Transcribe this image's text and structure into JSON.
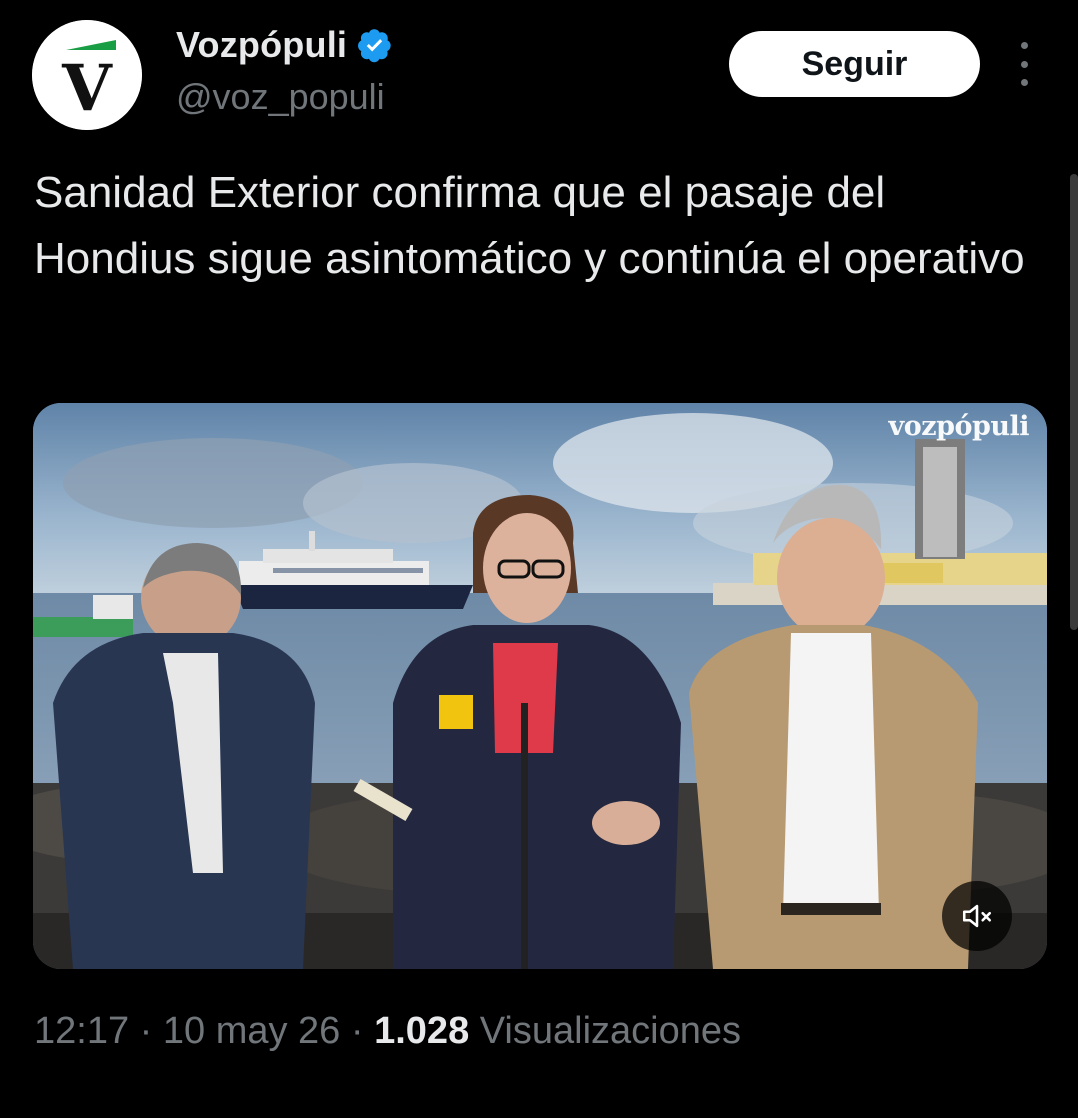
{
  "account": {
    "name": "Vozpópuli",
    "handle": "@voz_populi",
    "verified": true,
    "avatar_letter": "V"
  },
  "follow_button": {
    "label": "Seguir"
  },
  "more_icon": "more-vertical-icon",
  "tweet": {
    "text": "Sanidad Exterior confirma que el pasaje del Hondius sigue asintomático y continúa el operativo"
  },
  "media": {
    "watermark": "vozpópuli",
    "mute_icon": "speaker-muted-icon"
  },
  "meta": {
    "time": "12:17",
    "separator": "·",
    "date": "10 may 26",
    "views_count": "1.028",
    "views_label": "Visualizaciones"
  },
  "colors": {
    "background": "#000000",
    "text_primary": "#e7e9ea",
    "text_secondary": "#71767b",
    "verified_blue": "#1d9bf0",
    "brand_green": "#1a9e45"
  }
}
